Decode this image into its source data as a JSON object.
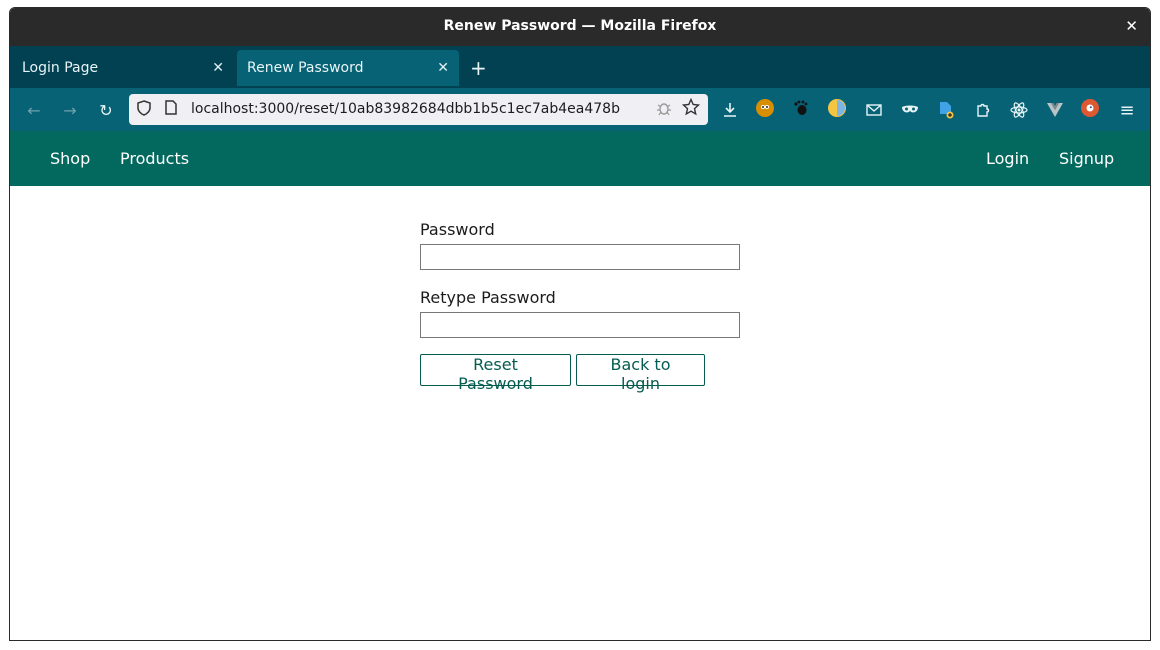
{
  "window": {
    "title": "Renew Password — Mozilla Firefox",
    "close_glyph": "✕"
  },
  "tabs": [
    {
      "label": "Login Page",
      "close": "✕"
    },
    {
      "label": "Renew Password",
      "close": "✕"
    }
  ],
  "newtab_glyph": "+",
  "toolbar": {
    "back_glyph": "←",
    "forward_glyph": "→",
    "reload_glyph": "↻",
    "url_host": "localhost",
    "url_path": ":3000/reset/10ab83982684dbb1b5c1ec7ab4ea478b",
    "menu_glyph": "≡"
  },
  "site_nav": {
    "left": [
      "Shop",
      "Products"
    ],
    "right": [
      "Login",
      "Signup"
    ]
  },
  "form": {
    "password_label": "Password",
    "password_value": "",
    "retype_label": "Retype Password",
    "retype_value": "",
    "reset_button": "Reset Password",
    "back_button": "Back to login"
  },
  "colors": {
    "titlebar": "#2a2a2a",
    "tabbar": "#014152",
    "toolbar": "#076275",
    "site_nav": "#03695e",
    "button_accent": "#055c50"
  }
}
